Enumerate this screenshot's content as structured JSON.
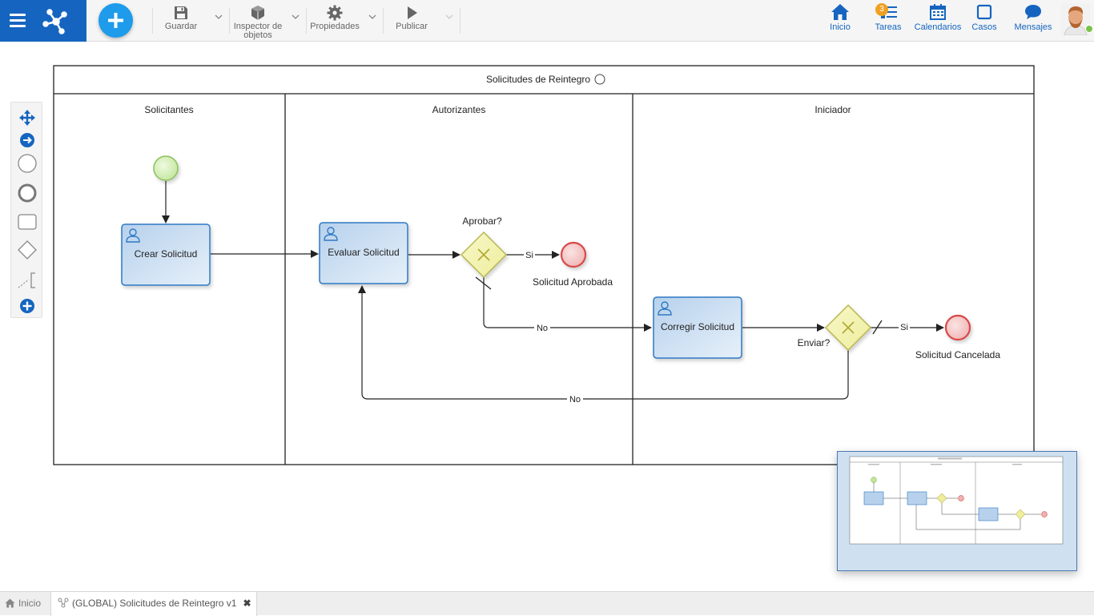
{
  "toolbar": {
    "save_label": "Guardar",
    "inspector_label_line1": "Inspector de",
    "inspector_label_line2": "objetos",
    "properties_label": "Propiedades",
    "publish_label": "Publicar"
  },
  "nav": {
    "home_label": "Inicio",
    "tasks_label": "Tareas",
    "tasks_badge": "3",
    "calendars_label": "Calendarios",
    "cases_label": "Casos",
    "messages_label": "Mensajes"
  },
  "colors": {
    "brand": "#1565c0",
    "accent": "#1e9bea",
    "task_fill": "#c6dcf0",
    "task_stroke": "#2f79c4",
    "gateway_fill": "#f3f3b0",
    "start_fill": "#d7f0b8",
    "end_fill": "#f3c4c4"
  },
  "diagram": {
    "pool_title": "Solicitudes de Reintegro",
    "lanes": [
      "Solicitantes",
      "Autorizantes",
      "Iniciador"
    ],
    "tasks": {
      "crear": "Crear Solicitud",
      "evaluar": "Evaluar Solicitud",
      "corregir": "Corregir Solicitud"
    },
    "gateways": {
      "aprobar": "Aprobar?",
      "enviar": "Enviar?"
    },
    "end_events": {
      "aprobada": "Solicitud Aprobada",
      "cancelada": "Solicitud Cancelada"
    },
    "flow_labels": {
      "si_1": "Si",
      "no_1": "No",
      "si_2": "Si",
      "no_2": "No"
    }
  },
  "tabs": {
    "home_label": "Inicio",
    "process_label": "(GLOBAL) Solicitudes de Reintegro v1",
    "close_symbol": "✖"
  },
  "icons": {
    "menu": "hamburger-menu-icon",
    "logo": "process-network-logo-icon",
    "new": "plus-icon",
    "save": "floppy-disk-icon",
    "inspector": "cube-icon",
    "properties": "gear-icon",
    "publish": "play-icon",
    "home": "house-icon",
    "tasks": "task-list-icon",
    "calendars": "calendar-icon",
    "cases": "square-case-icon",
    "messages": "chat-bubble-icon"
  }
}
